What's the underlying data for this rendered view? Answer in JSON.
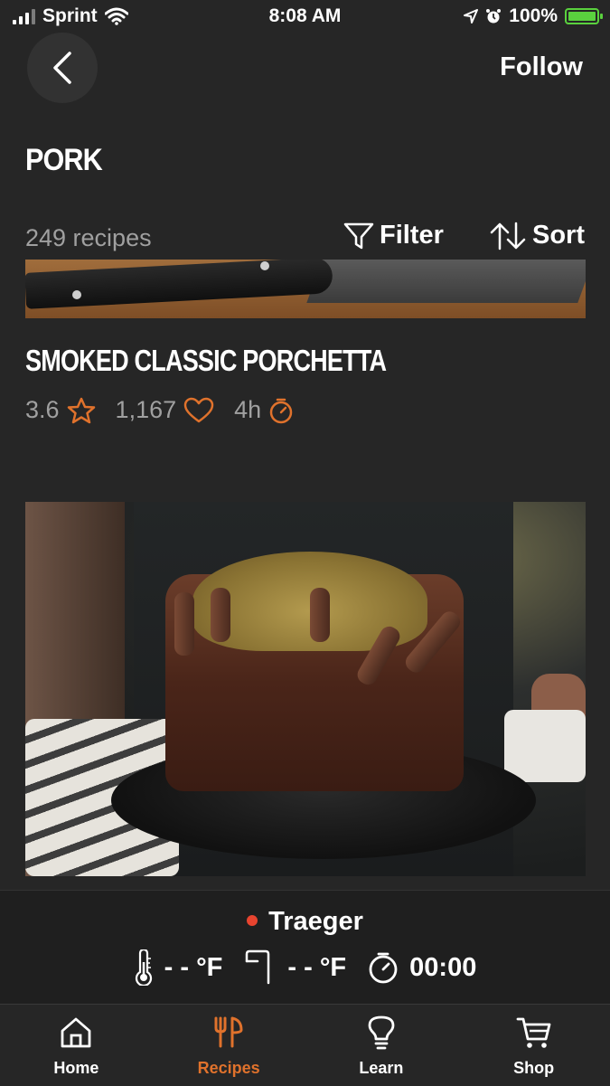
{
  "status_bar": {
    "carrier": "Sprint",
    "time": "8:08 AM",
    "battery": "100%"
  },
  "header": {
    "follow_label": "Follow",
    "title": "PORK"
  },
  "toolbar": {
    "count": "249 recipes",
    "filter_label": "Filter",
    "sort_label": "Sort"
  },
  "recipes": [
    {
      "title": "SMOKED CLASSIC PORCHETTA",
      "rating": "3.6",
      "likes": "1,167",
      "time": "4h"
    }
  ],
  "grill": {
    "name": "Traeger",
    "grill_temp": "- - °F",
    "probe_temp": "- - °F",
    "timer": "00:00",
    "status_color": "#e8442f"
  },
  "nav": {
    "items": [
      {
        "label": "Home",
        "icon": "home-icon"
      },
      {
        "label": "Recipes",
        "icon": "fork-knife-icon",
        "active": true
      },
      {
        "label": "Learn",
        "icon": "lightbulb-icon"
      },
      {
        "label": "Shop",
        "icon": "cart-icon"
      }
    ]
  },
  "colors": {
    "accent": "#e0722c",
    "background": "#262626",
    "muted_text": "#a0a0a0"
  }
}
